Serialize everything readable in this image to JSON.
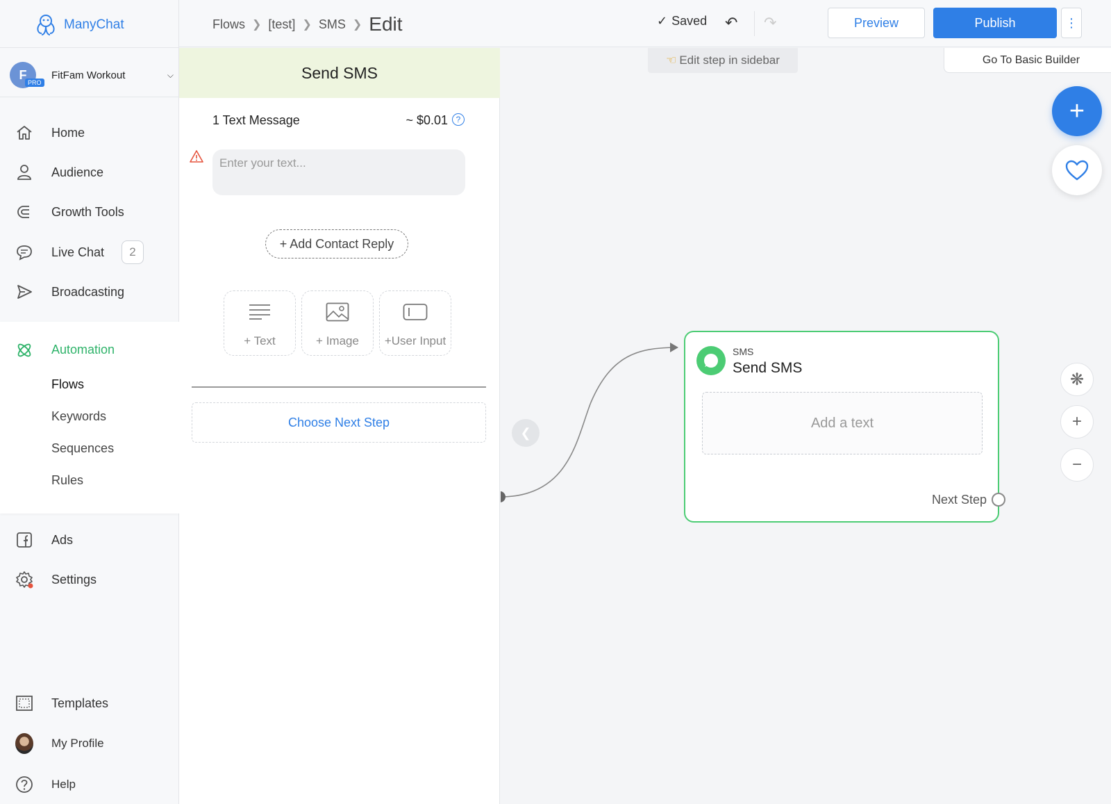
{
  "app": {
    "name": "ManyChat"
  },
  "account": {
    "initial": "F",
    "badge": "PRO",
    "name": "FitFam Workout"
  },
  "sidebar": {
    "main_items": [
      {
        "label": "Home",
        "icon": "home-icon"
      },
      {
        "label": "Audience",
        "icon": "user-icon"
      },
      {
        "label": "Growth Tools",
        "icon": "magnet-icon"
      },
      {
        "label": "Live Chat",
        "icon": "chat-bubble-icon",
        "badge": "2"
      },
      {
        "label": "Broadcasting",
        "icon": "send-icon"
      }
    ],
    "automation": {
      "label": "Automation",
      "icon": "atom-icon",
      "sub_items": [
        "Flows",
        "Keywords",
        "Sequences",
        "Rules"
      ],
      "active_sub": "Flows"
    },
    "lower_items": [
      {
        "label": "Ads",
        "icon": "facebook-icon"
      },
      {
        "label": "Settings",
        "icon": "gear-icon"
      }
    ],
    "bottom_items": [
      {
        "label": "Templates",
        "icon": "template-icon"
      },
      {
        "label": "My Profile",
        "icon": "avatar"
      },
      {
        "label": "Help",
        "icon": "question-icon"
      }
    ]
  },
  "header": {
    "breadcrumb": [
      "Flows",
      "[test]",
      "SMS"
    ],
    "current": "Edit",
    "saved_label": "Saved",
    "preview_label": "Preview",
    "publish_label": "Publish"
  },
  "panel": {
    "title": "Send SMS",
    "message_count": "1 Text Message",
    "price": "~ $0.01",
    "help_glyph": "?",
    "text_placeholder": "Enter your text...",
    "add_reply_label": "+ Add Contact Reply",
    "blocks": [
      {
        "label": "+ Text",
        "icon": "text-lines-icon"
      },
      {
        "label": "+ Image",
        "icon": "image-icon"
      },
      {
        "label": "+User Input",
        "icon": "input-box-icon"
      }
    ],
    "next_step_label": "Choose Next Step"
  },
  "canvas": {
    "hint": "Edit step in sidebar",
    "basic_builder_label": "Go To Basic Builder",
    "node": {
      "type": "SMS",
      "title": "Send SMS",
      "add_text_label": "Add a text",
      "next_step_label": "Next Step"
    },
    "colors": {
      "accent": "#2f7fe6",
      "node_border": "#4ccc74",
      "active_nav": "#2fb36a"
    }
  }
}
